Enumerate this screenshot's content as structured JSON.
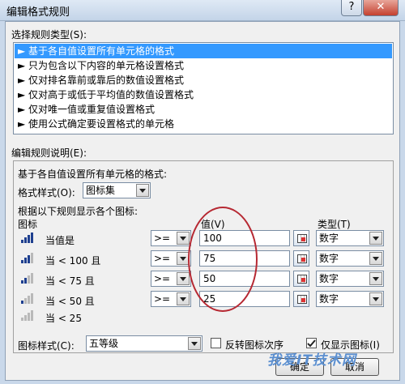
{
  "window": {
    "title": "编辑格式规则",
    "help": "?",
    "close": "✕"
  },
  "rule_type": {
    "label": "选择规则类型(S):",
    "items": [
      "► 基于各自值设置所有单元格的格式",
      "► 只为包含以下内容的单元格设置格式",
      "► 仅对排名靠前或靠后的数值设置格式",
      "► 仅对高于或低于平均值的数值设置格式",
      "► 仅对唯一值或重复值设置格式",
      "► 使用公式确定要设置格式的单元格"
    ]
  },
  "edit": {
    "label": "编辑规则说明(E):",
    "heading": "基于各自值设置所有单元格的格式:",
    "format_style_label": "格式样式(O):",
    "format_style_value": "图标集",
    "rule_caption": "根据以下规则显示各个图标:",
    "col_icon": "图标",
    "col_value": "值(V)",
    "col_type": "类型(T)",
    "rows": [
      {
        "text": "当值是",
        "op": ">=",
        "value": "100",
        "type": "数字",
        "level": 4
      },
      {
        "text": "当 < 100 且",
        "op": ">=",
        "value": "75",
        "type": "数字",
        "level": 3
      },
      {
        "text": "当 < 75 且",
        "op": ">=",
        "value": "50",
        "type": "数字",
        "level": 2
      },
      {
        "text": "当 < 50 且",
        "op": ">=",
        "value": "25",
        "type": "数字",
        "level": 1
      },
      {
        "text": "当 < 25",
        "level": 0
      }
    ],
    "icon_style_label": "图标样式(C):",
    "icon_style_value": "五等级",
    "reverse_label": "反转图标次序",
    "reverse_checked": false,
    "show_icon_only_label": "仅显示图标(I)",
    "show_icon_only_checked": true
  },
  "buttons": {
    "ok": "确定",
    "cancel": "取消"
  },
  "watermark": "我爱IT技术网",
  "colors": {
    "selection": "#3399ff",
    "bar_on": "#1e3f8f",
    "bar_off": "#b9b9b9",
    "annotation": "#b62832"
  }
}
